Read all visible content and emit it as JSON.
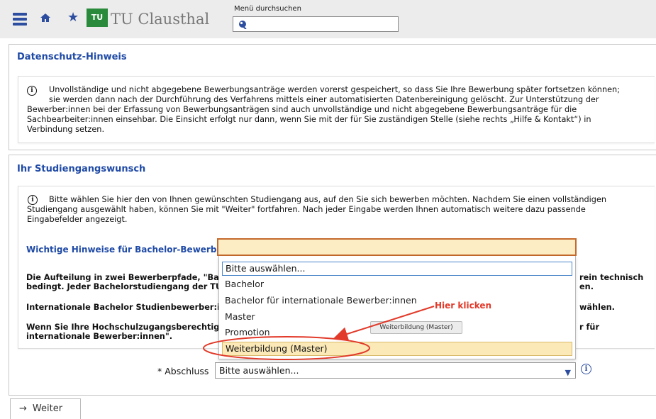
{
  "header": {
    "logo_text": "TU",
    "brand": "TU Clausthal",
    "search_label": "Menü durchsuchen",
    "search_value": ""
  },
  "privacy": {
    "title": "Datenschutz-Hinweis",
    "lines": [
      "Unvollständige und nicht abgegebene Bewerbungsanträge werden vorerst gespeichert, so dass Sie Ihre Bewerbung später fortsetzen können;",
      "sie werden dann nach der Durchführung des Verfahrens mittels einer automatisierten Datenbereinigung gelöscht. Zur Unterstützung der",
      "Bewerber:innen bei der Erfassung von Bewerbungsanträgen sind auch unvollständige und nicht abgegebene Bewerbungsanträge für die",
      "Sachbearbeiter:innen einsehbar. Die Einsicht erfolgt nur dann, wenn Sie mit der für Sie zuständigen Stelle (siehe rechts „Hilfe & Kontakt“) in",
      "Verbindung setzen."
    ]
  },
  "study": {
    "title": "Ihr Studiengangswunsch",
    "info_lines": [
      "Bitte wählen Sie hier den von Ihnen gewünschten Studiengang aus, auf den Sie sich bewerben möchten. Nachdem Sie einen vollständigen",
      "Studiengang ausgewählt haben, können Sie mit \"Weiter\" fortfahren. Nach jeder Eingabe werden Ihnen automatisch weitere dazu passende",
      "Eingabefelder angezeigt."
    ],
    "hint_heading": "Wichtige Hinweise für Bachelor-Bewerber",
    "left_texts": [
      "Die Aufteilung in zwei Bewerberpfade, \"Bach",
      "bedingt. Jeder Bachelorstudiengang der TU C",
      "Internationale Bachelor Studienbewerber:in",
      "Wenn Sie Ihre Hochschulzugangsberechtigu",
      "internationale Bewerber:innen\"."
    ],
    "right_texts": [
      "rein technisch",
      "en.",
      "wählen.",
      "r für"
    ]
  },
  "dropdown": {
    "search_value": "",
    "options": [
      "Bitte auswählen...",
      "Bachelor",
      "Bachelor für internationale Bewerber:innen",
      "Master",
      "Promotion",
      "Weiterbildung (Master)"
    ],
    "tooltip": "Weiterbildung (Master)"
  },
  "annotation": {
    "text": "Hier klicken",
    "color": "#e23a2a"
  },
  "form": {
    "label": "* Abschluss",
    "select_value": "Bitte auswählen..."
  },
  "footer": {
    "button_label": "Weiter"
  },
  "colors": {
    "accent": "#1f4aa6",
    "highlight": "#fdedc5",
    "border_highlight": "#c46a2c"
  }
}
